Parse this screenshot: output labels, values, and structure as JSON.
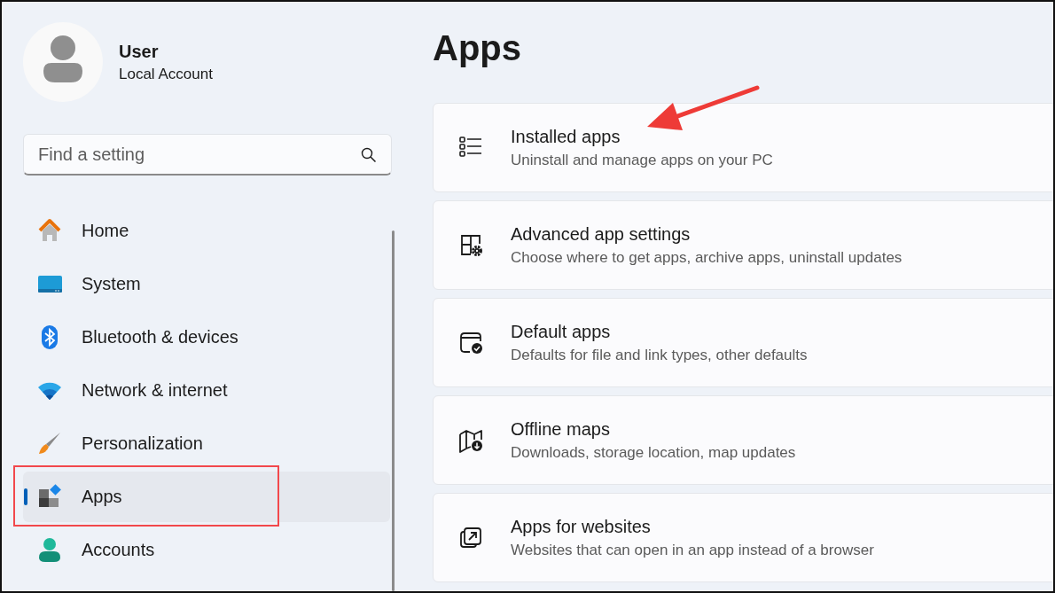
{
  "profile": {
    "name": "User",
    "account": "Local Account"
  },
  "search": {
    "placeholder": "Find a setting"
  },
  "nav": [
    {
      "label": "Home",
      "selected": false
    },
    {
      "label": "System",
      "selected": false
    },
    {
      "label": "Bluetooth & devices",
      "selected": false
    },
    {
      "label": "Network & internet",
      "selected": false
    },
    {
      "label": "Personalization",
      "selected": false
    },
    {
      "label": "Apps",
      "selected": true
    },
    {
      "label": "Accounts",
      "selected": false
    }
  ],
  "page_title": "Apps",
  "cards": [
    {
      "title": "Installed apps",
      "subtitle": "Uninstall and manage apps on your PC"
    },
    {
      "title": "Advanced app settings",
      "subtitle": "Choose where to get apps, archive apps, uninstall updates"
    },
    {
      "title": "Default apps",
      "subtitle": "Defaults for file and link types, other defaults"
    },
    {
      "title": "Offline maps",
      "subtitle": "Downloads, storage location, map updates"
    },
    {
      "title": "Apps for websites",
      "subtitle": "Websites that can open in an app instead of a browser"
    }
  ]
}
